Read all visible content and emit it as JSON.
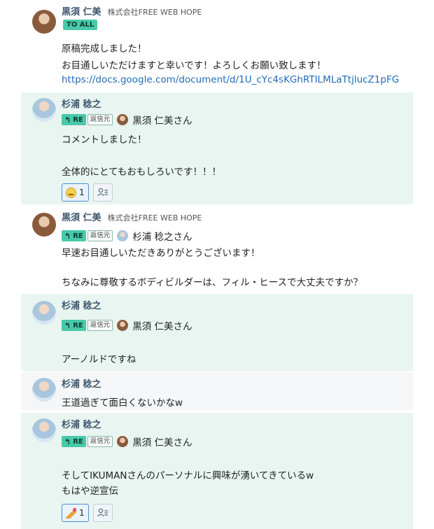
{
  "messages": [
    {
      "sender": "黒須 仁美",
      "company": "株式会社FREE WEB HOPE",
      "to_all_label": "TO ALL",
      "lines": [
        "原稿完成しました！",
        "お目通しいただけますと幸いです！よろしくお願い致します！"
      ],
      "link": "https://docs.google.com/document/d/1U_cYc4sKGhRTILMLaTtjlucZ1pFG"
    },
    {
      "sender": "杉浦 稔之",
      "reply_label": "RE",
      "source_label": "返信元",
      "reply_to": "黒須 仁美さん",
      "lines": [
        "コメントしました！",
        "全体的にとてもおもしろいです！！！"
      ],
      "reaction_count": "1"
    },
    {
      "sender": "黒須 仁美",
      "company": "株式会社FREE WEB HOPE",
      "reply_label": "RE",
      "source_label": "返信元",
      "reply_to": "杉浦 稔之さん",
      "lines": [
        "早速お目通しいただきありがとうございます！",
        "ちなみに尊敬するボディビルダーは、フィル・ヒースで大丈夫ですか？"
      ]
    },
    {
      "sender": "杉浦 稔之",
      "reply_label": "RE",
      "source_label": "返信元",
      "reply_to": "黒須 仁美さん",
      "lines": [
        "アーノルドですね"
      ]
    },
    {
      "sender": "杉浦 稔之",
      "lines": [
        "王道過ぎて面白くないかなw"
      ]
    },
    {
      "sender": "杉浦 稔之",
      "reply_label": "RE",
      "source_label": "返信元",
      "reply_to": "黒須 仁美さん",
      "lines": [
        "そしてIKUMANさんのパーソナルに興味が湧いてきているw",
        "もはや逆宣伝"
      ],
      "reaction_count": "1"
    }
  ]
}
